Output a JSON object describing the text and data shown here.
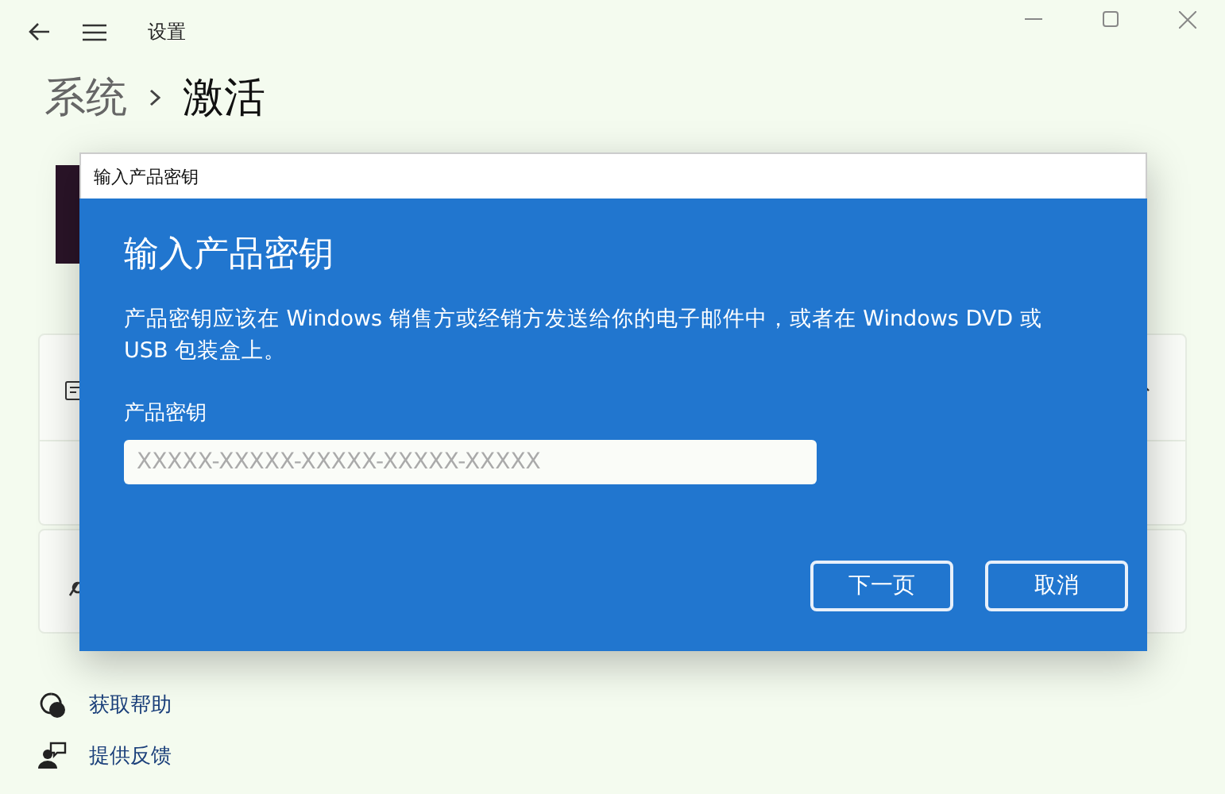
{
  "window": {
    "title": "设置"
  },
  "breadcrumb": {
    "parent": "系统",
    "current": "激活"
  },
  "dialog": {
    "title": "输入产品密钥",
    "heading": "输入产品密钥",
    "description": "产品密钥应该在 Windows 销售方或经销方发送给你的电子邮件中，或者在 Windows DVD 或 USB 包装盒上。",
    "field_label": "产品密钥",
    "field": {
      "placeholder": "XXXXX-XXXXX-XXXXX-XXXXX-XXXXX"
    },
    "buttons": [
      "下一页",
      "取消"
    ]
  },
  "links": [
    {
      "kind": "help",
      "label": "获取帮助"
    },
    {
      "kind": "feedback",
      "label": "提供反馈"
    }
  ]
}
